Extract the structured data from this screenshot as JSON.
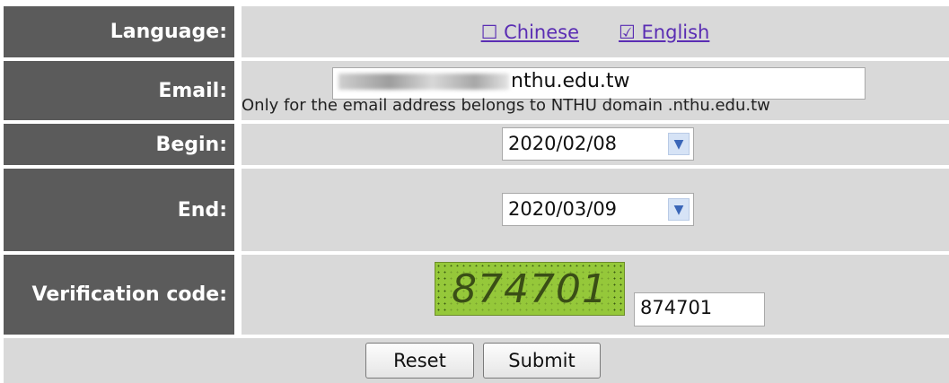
{
  "labels": {
    "language": "Language:",
    "email": "Email:",
    "begin": "Begin:",
    "end": "End:",
    "verification": "Verification code:"
  },
  "language": {
    "chinese": "☐ Chinese",
    "english": "☑ English"
  },
  "email": {
    "value_visible": "nthu.edu.tw",
    "hint": "Only for the email address belongs to NTHU domain .nthu.edu.tw"
  },
  "begin": {
    "value": "2020/02/08"
  },
  "end": {
    "value": "2020/03/09"
  },
  "captcha": {
    "image_text": "874701",
    "input_value": "874701"
  },
  "buttons": {
    "reset": "Reset",
    "submit": "Submit"
  },
  "colors": {
    "label_bg": "#5b5b5b",
    "value_bg": "#d9d9d9",
    "link": "#5a2db3",
    "captcha_bg": "#95c83a"
  }
}
